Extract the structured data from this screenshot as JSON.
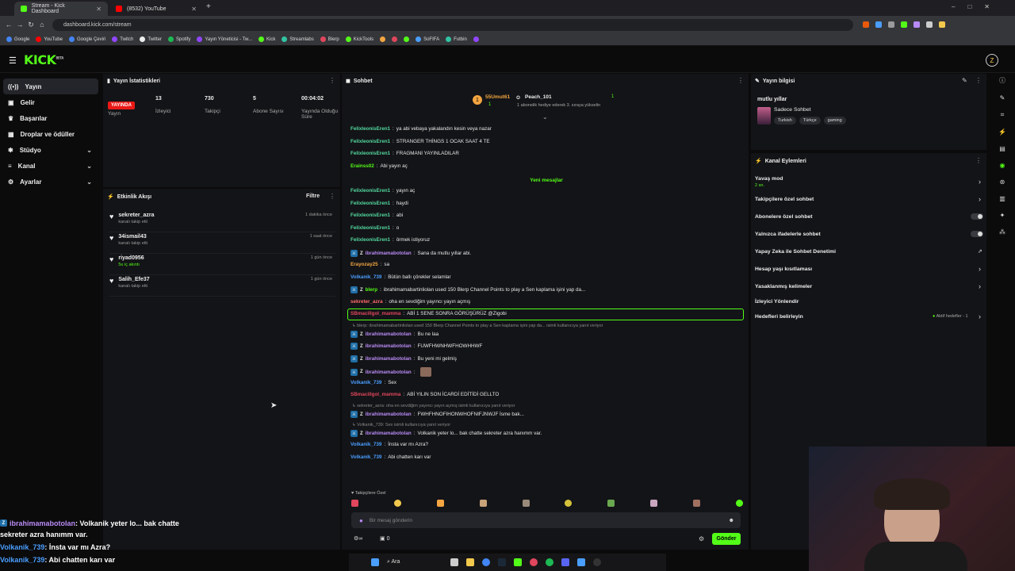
{
  "browser": {
    "tabs": [
      {
        "title": "Stream - Kick Dashboard",
        "color": "#53fc18"
      },
      {
        "title": "(8532) YouTube",
        "color": "#ff0000"
      }
    ],
    "url": "dashboard.kick.com/stream",
    "bookmarks": [
      "Google",
      "YouTube",
      "Google Çeviri",
      "Twitch",
      "Twitter",
      "Spotify",
      "Yayın Yöneticisi - Tw...",
      "Kick",
      "Streamlabs",
      "Blerp",
      "KickTools",
      "SoFIFA",
      "Futbin"
    ]
  },
  "kick": {
    "logo": "KICK",
    "logo_badge": "BETA"
  },
  "sidebar": {
    "items": [
      {
        "label": "Yayın",
        "icon": "broadcast-icon",
        "chevron": false
      },
      {
        "label": "Gelir",
        "icon": "wallet-icon",
        "chevron": false
      },
      {
        "label": "Başarılar",
        "icon": "trophy-icon",
        "chevron": false
      },
      {
        "label": "Droplar ve ödüller",
        "icon": "gift-icon",
        "chevron": false
      },
      {
        "label": "Stüdyo",
        "icon": "studio-icon",
        "chevron": true
      },
      {
        "label": "Kanal",
        "icon": "channel-icon",
        "chevron": true
      },
      {
        "label": "Ayarlar",
        "icon": "gear-icon",
        "chevron": true
      }
    ]
  },
  "stats": {
    "title": "Yayın İstatistikleri",
    "live": "YAYINDA",
    "live_label": "Yayın",
    "items": [
      {
        "value": "13",
        "label": "İzleyici"
      },
      {
        "value": "730",
        "label": "Takipçi"
      },
      {
        "value": "5",
        "label": "Abone Sayısı"
      },
      {
        "value": "00:04:02",
        "label": "Yayında Olduğu Süre"
      }
    ]
  },
  "activity": {
    "title": "Etkinlik Akışı",
    "filter": "Filtre",
    "items": [
      {
        "name": "sekreter_azra",
        "sub": "kanalı takip etti",
        "time": "1 dakika önce",
        "subcolor": "#9a9a9a"
      },
      {
        "name": "34ismail43",
        "sub": "kanalı takip etti",
        "time": "1 saat önce",
        "subcolor": "#9a9a9a"
      },
      {
        "name": "riyad0956",
        "sub": "5u iç akıntı",
        "time": "1 gün önce",
        "subcolor": "#53fc18"
      },
      {
        "name": "Salih_Efe37",
        "sub": "kanalı takip etti",
        "time": "1 gün önce",
        "subcolor": "#9a9a9a"
      }
    ]
  },
  "chat": {
    "title": "Sohbet",
    "pinned": {
      "user1": "55Umut61",
      "count1": "1",
      "user2": "Peach_101",
      "count2": "1",
      "note": "1 abonelik hediye ederek 3. sıraya yükselin"
    },
    "new_messages": "Yeni mesajlar",
    "messages": [
      {
        "user": "FelixleonisEren1",
        "text": "ya abi vebaya yakalandın kesin veya nazar",
        "color": "#53d9a0",
        "badges": 0
      },
      {
        "user": "FelixleonisEren1",
        "text": "STRANGER THİNGS 1 OCAK SAAT 4 TE",
        "color": "#53d9a0",
        "badges": 0
      },
      {
        "user": "FelixleonisEren1",
        "text": "FRAGMANI YAYINLADILAR",
        "color": "#53d9a0",
        "badges": 0
      },
      {
        "user": "Erainss02",
        "text": "Abi yayın aç",
        "color": "#53fc18",
        "badges": 0
      },
      {
        "user": "FelixleonisEren1",
        "text": "yayın aç",
        "color": "#53d9a0",
        "badges": 0
      },
      {
        "user": "FelixleonisEren1",
        "text": "haydi",
        "color": "#53d9a0",
        "badges": 0
      },
      {
        "user": "FelixleonisEren1",
        "text": "abi",
        "color": "#53d9a0",
        "badges": 0
      },
      {
        "user": "FelixleonisEren1",
        "text": "o",
        "color": "#53d9a0",
        "badges": 0
      },
      {
        "user": "FelixleonisEren1",
        "text": "örmek istiyoruz",
        "color": "#53d9a0",
        "badges": 0
      },
      {
        "user": "ibrahimamabotolan",
        "text": "Sana da mutlu yıllar abi.",
        "color": "#b98af5",
        "badges": 2
      },
      {
        "user": "Erayozay25",
        "text": "sa",
        "color": "#f2a541",
        "badges": 0
      },
      {
        "user": "Volkanik_739",
        "text": "Bütün ballı çörekler selamlar",
        "color": "#4a9eff",
        "badges": 0
      },
      {
        "user": "blerp",
        "text": "ibrahimamabartinliolan used 150 Blerp Channel Points to play a Sen kaplama işini yap da...",
        "color": "#53fc18",
        "badges": 2
      },
      {
        "user": "sekreter_azra",
        "text": "oha en sevdiğim yayıncı yayın açmış",
        "color": "#ff6b6b",
        "badges": 0
      },
      {
        "user": "SBmacillgol_mamma",
        "text": "ABİ 1 SENE SONRA GÖRÜŞÜRÜZ @Zigobi",
        "color": "#e0465c",
        "badges": 0
      },
      {
        "user": "ibrahimamabotolan",
        "text": "Bu ne laa",
        "color": "#b98af5",
        "badges": 2
      },
      {
        "user": "ibrahimamabotolan",
        "text": "FUWFHWNHWFHOWHHWF",
        "color": "#b98af5",
        "badges": 2
      },
      {
        "user": "ibrahimamabotolan",
        "text": "Bu yeni mi gelmiş",
        "color": "#b98af5",
        "badges": 2
      },
      {
        "user": "ibrahimamabotolan",
        "text": "",
        "color": "#b98af5",
        "badges": 2
      },
      {
        "user": "Volkanik_739",
        "text": "Sex",
        "color": "#4a9eff",
        "badges": 0
      },
      {
        "user": "SBmacillgol_mamma",
        "text": "ABİ YILIN SON İCARDİ EDİTİDİ GELLTO",
        "color": "#e0465c",
        "badges": 0
      },
      {
        "user": "ibrahimamabotolan",
        "text": "FWHFHNOFIHONWHOFNIFJNWJF İsme bak...",
        "color": "#b98af5",
        "badges": 2
      },
      {
        "user": "ibrahimamabotolan",
        "text": "Volkanik yeter lo... bak chatte sekreter azra hanımm var.",
        "color": "#b98af5",
        "badges": 2
      },
      {
        "user": "Volkanik_739",
        "text": "İnsta var mı Azra?",
        "color": "#4a9eff",
        "badges": 0
      },
      {
        "user": "Volkanik_739",
        "text": "Abi chatten karı var",
        "color": "#4a9eff",
        "badges": 0
      }
    ],
    "replies": [
      "blerp: ibrahimamabartinliolan used 150 Blerp Channel Points to play a Sen kaplama işini yap da... isimli kullanıcıya yanıt veriyor",
      "sekreter_azra: oha en sevdiğim yayıncı yayın açmış isimli kullanıcıya yanıt veriyor",
      "Volkanik_739: Sex isimli kullanıcıya yanıt veriyor"
    ],
    "followers_only": "Takipçilere Özel",
    "input_placeholder": "Bir mesaj gönderin",
    "points": "0",
    "send": "Gönder",
    "infinity": "∞"
  },
  "stream_info": {
    "title": "Yayın bilgisi",
    "stream_title": "mutlu yıllar",
    "category": "Sadece Sohbet",
    "tags": [
      "Turkish",
      "Türkçe",
      "gaming"
    ]
  },
  "channel_actions": {
    "title": "Kanal Eylemleri",
    "slow_mode": "Yavaş mod",
    "slow_mode_value": "2 sn.",
    "items": [
      "Takipçilere özel sohbet",
      "Abonelere özel sohbet",
      "Yalnızca ifadelerle sohbet",
      "Yapay Zeka ile Sohbet Denetimi",
      "Hesap yaşı kısıtlaması",
      "Yasaklanmış kelimeler",
      "İzleyici Yönlendir",
      "Hedefleri belirleyin"
    ],
    "goals_badge": "Aktif hedefler - 1"
  },
  "overlay": {
    "lines": [
      {
        "user": "ibrahimamabotolan",
        "text": ": Volkanik yeter lo... bak chatte",
        "color": "#b98af5"
      },
      {
        "user": "",
        "text": "sekreter azra hanımm var.",
        "color": "#fff"
      },
      {
        "user": "Volkanik_739",
        "text": ": İnsta var mı Azra?",
        "color": "#4a9eff"
      },
      {
        "user": "Volkanik_739",
        "text": ": Abi chatten karı var",
        "color": "#4a9eff"
      }
    ]
  },
  "taskbar": {
    "search": "Ara"
  },
  "colors": {
    "accent": "#53fc18",
    "live": "#e91916",
    "panel": "#131417"
  }
}
